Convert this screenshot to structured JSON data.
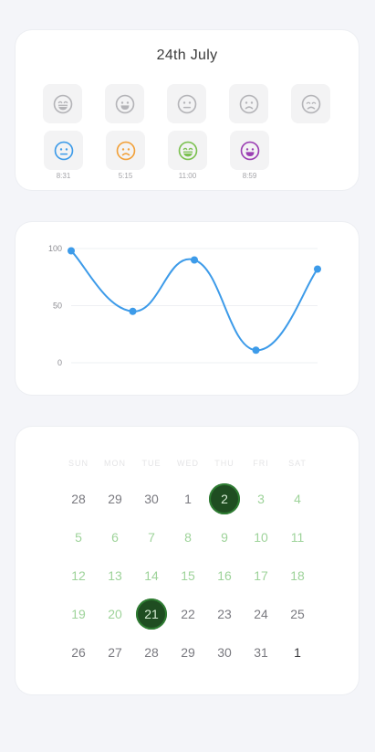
{
  "mood_card": {
    "date": "24th July",
    "options": [
      {
        "icon": "laughing-face-icon",
        "color": "#b4b4b8"
      },
      {
        "icon": "grinning-face-icon",
        "color": "#b4b4b8"
      },
      {
        "icon": "neutral-face-icon",
        "color": "#b4b4b8"
      },
      {
        "icon": "sad-face-icon",
        "color": "#b4b4b8"
      },
      {
        "icon": "crying-face-icon",
        "color": "#b4b4b8"
      }
    ],
    "entries": [
      {
        "icon": "neutral-face-icon",
        "color": "#3d9be9",
        "time": "8:31"
      },
      {
        "icon": "sad-face-icon",
        "color": "#f2a13a",
        "time": "5:15"
      },
      {
        "icon": "laughing-face-icon",
        "color": "#7cc151",
        "time": "11:00"
      },
      {
        "icon": "grinning-face-icon",
        "color": "#9b3fb3",
        "time": "8:59"
      }
    ]
  },
  "chart_data": {
    "type": "line",
    "y_ticks": [
      "100",
      "50",
      "0"
    ],
    "ylim": [
      0,
      100
    ],
    "series": [
      {
        "values": [
          98,
          45,
          90,
          11,
          82
        ]
      }
    ],
    "color": "#3d9be9",
    "grid": true
  },
  "calendar": {
    "weekdays": [
      "SUN",
      "MON",
      "TUE",
      "WED",
      "THU",
      "FRI",
      "SAT"
    ],
    "weeks": [
      [
        {
          "d": "28",
          "s": "muted"
        },
        {
          "d": "29",
          "s": "muted"
        },
        {
          "d": "30",
          "s": "muted"
        },
        {
          "d": "1",
          "s": "muted"
        },
        {
          "d": "2",
          "s": "selected"
        },
        {
          "d": "3",
          "s": "green"
        },
        {
          "d": "4",
          "s": "green"
        }
      ],
      [
        {
          "d": "5",
          "s": "green"
        },
        {
          "d": "6",
          "s": "green"
        },
        {
          "d": "7",
          "s": "green"
        },
        {
          "d": "8",
          "s": "green"
        },
        {
          "d": "9",
          "s": "green"
        },
        {
          "d": "10",
          "s": "green"
        },
        {
          "d": "11",
          "s": "green"
        }
      ],
      [
        {
          "d": "12",
          "s": "green"
        },
        {
          "d": "13",
          "s": "green"
        },
        {
          "d": "14",
          "s": "green"
        },
        {
          "d": "15",
          "s": "green"
        },
        {
          "d": "16",
          "s": "green"
        },
        {
          "d": "17",
          "s": "green"
        },
        {
          "d": "18",
          "s": "green"
        }
      ],
      [
        {
          "d": "19",
          "s": "green"
        },
        {
          "d": "20",
          "s": "green"
        },
        {
          "d": "21",
          "s": "selected"
        },
        {
          "d": "22",
          "s": "muted"
        },
        {
          "d": "23",
          "s": "muted"
        },
        {
          "d": "24",
          "s": "muted"
        },
        {
          "d": "25",
          "s": "muted"
        }
      ],
      [
        {
          "d": "26",
          "s": "muted"
        },
        {
          "d": "27",
          "s": "muted"
        },
        {
          "d": "28",
          "s": "muted"
        },
        {
          "d": "29",
          "s": "muted"
        },
        {
          "d": "30",
          "s": "muted"
        },
        {
          "d": "31",
          "s": "muted"
        },
        {
          "d": "1",
          "s": "gray"
        }
      ]
    ]
  }
}
